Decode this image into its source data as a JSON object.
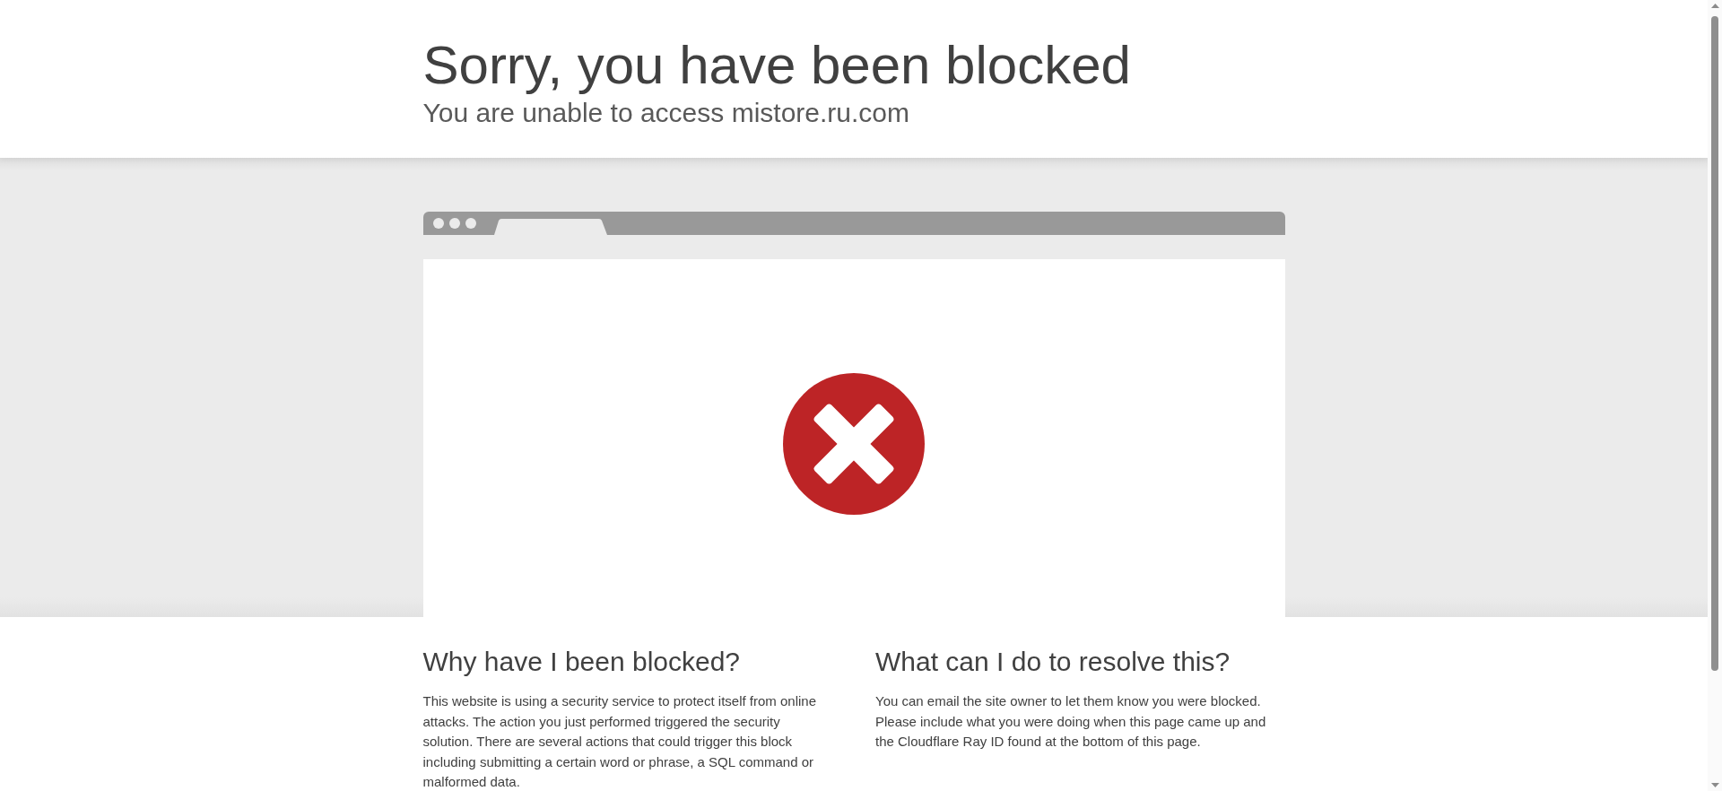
{
  "header": {
    "title": "Sorry, you have been blocked",
    "subtitle": "You are unable to access mistore.ru.com"
  },
  "sections": [
    {
      "heading": "Why have I been blocked?",
      "text": "This website is using a security service to protect itself from online attacks. The action you just performed triggered the security solution. There are several actions that could trigger this block including submitting a certain word or phrase, a SQL command or malformed data."
    },
    {
      "heading": "What can I do to resolve this?",
      "text": "You can email the site owner to let them know you were blocked. Please include what you were doing when this page came up and the Cloudflare Ray ID found at the bottom of this page."
    }
  ]
}
